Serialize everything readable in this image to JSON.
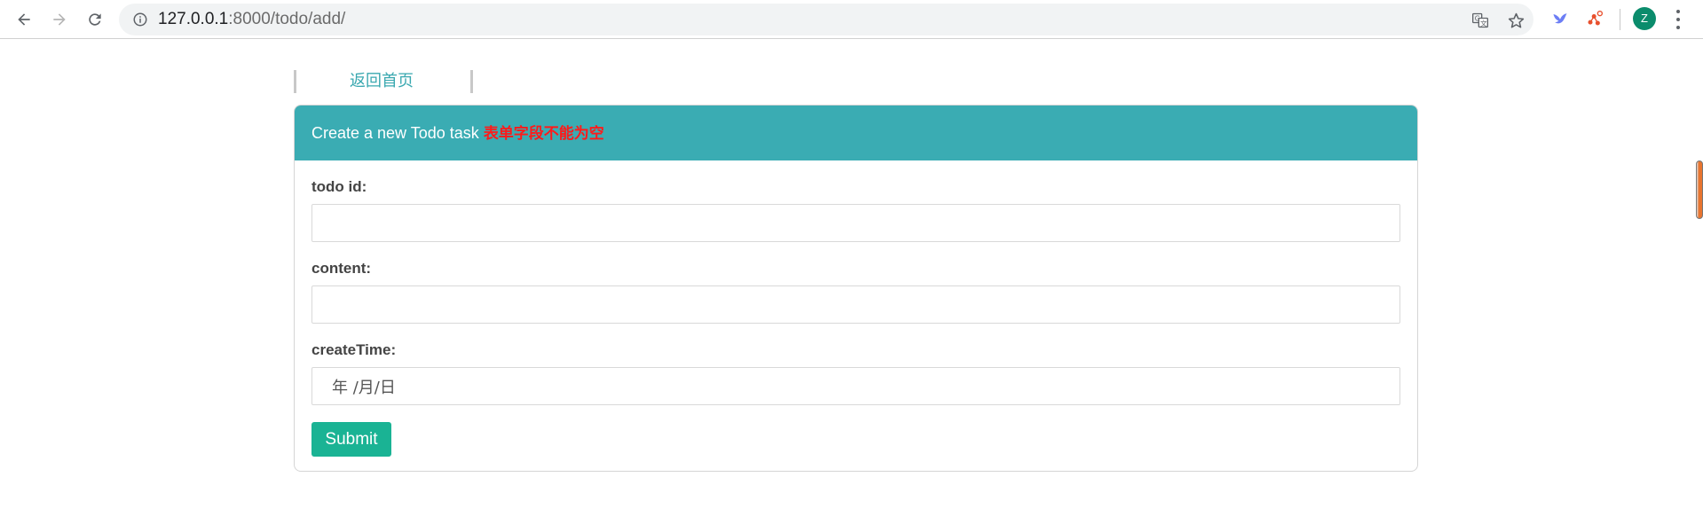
{
  "browser": {
    "url_host": "127.0.0.1",
    "url_rest": ":8000/todo/add/",
    "avatar_letter": "Z",
    "icons": {
      "back": "back-arrow-icon",
      "forward": "forward-arrow-icon",
      "reload": "reload-icon",
      "site_info": "info-icon",
      "translate": "translate-icon",
      "bookmark": "star-icon",
      "ext1": "bird-extension-icon",
      "ext2": "network-extension-icon",
      "menu": "kebab-menu-icon"
    }
  },
  "nav": {
    "home_link": "返回首页"
  },
  "form": {
    "header_title": "Create a new Todo task ",
    "header_warning": "表单字段不能为空",
    "fields": [
      {
        "label": "todo id:",
        "value": "",
        "placeholder": ""
      },
      {
        "label": "content:",
        "value": "",
        "placeholder": ""
      },
      {
        "label": "createTime:",
        "value": "年 /月/日",
        "placeholder": ""
      }
    ],
    "submit_label": "Submit"
  },
  "colors": {
    "header_bg": "#3aacb3",
    "link": "#3aa8b0",
    "warning": "#ff1a1a",
    "submit_bg": "#1ab394"
  }
}
